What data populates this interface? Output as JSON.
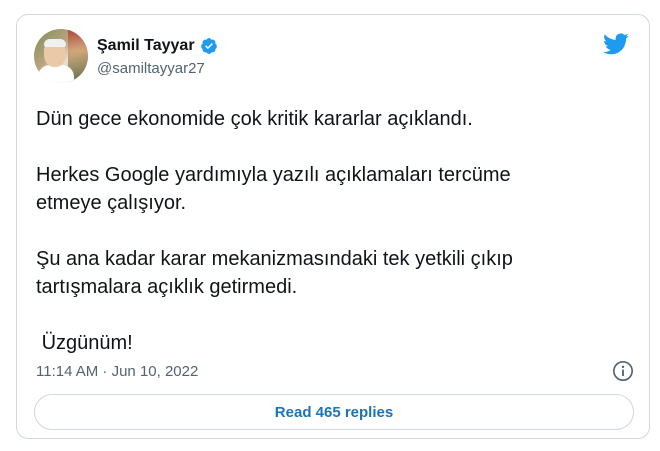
{
  "author": {
    "name": "Şamil Tayyar",
    "handle": "@samiltayyar27",
    "verified": true
  },
  "tweet": {
    "paragraphs": [
      "Dün gece ekonomide çok kritik kararlar açıklandı.",
      "Herkes Google yardımıyla yazılı açıklamaları tercüme etmeye çalışıyor.",
      "Şu ana kadar karar mekanizmasındaki tek yetkili çıkıp tartışmalara açıklık getirmedi.",
      " Üzgünüm!"
    ],
    "timestamp": "11:14 AM · Jun 10, 2022"
  },
  "actions": {
    "replies_label": "Read 465 replies"
  },
  "icons": {
    "brand": "twitter-bird-icon",
    "verified": "verified-badge-icon",
    "info": "info-icon"
  },
  "colors": {
    "brand_blue": "#1d9bf0",
    "link_blue": "#1b74b6",
    "secondary_text": "#536471",
    "border": "#cfd9de"
  }
}
